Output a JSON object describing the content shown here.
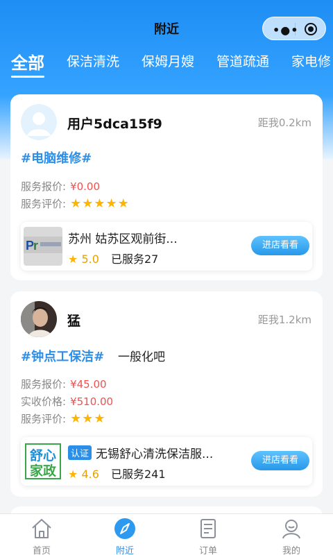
{
  "navbar": {
    "title": "附近"
  },
  "tabs": [
    {
      "label": "全部",
      "active": true
    },
    {
      "label": "保洁清洗"
    },
    {
      "label": "保姆月嫂"
    },
    {
      "label": "管道疏通"
    },
    {
      "label": "家电修"
    }
  ],
  "cards": [
    {
      "username": "用户5dca15f9",
      "distance": "距我0.2km",
      "tag": "#电脑维修#",
      "desc": "",
      "price_label": "服务报价:",
      "price_value": "¥0.00",
      "rating_label": "服务评价:",
      "stars": "★★★★★",
      "rating_level": 5,
      "shop": {
        "badge": "",
        "name": "苏州 姑苏区观前街...",
        "score": "5.0",
        "served": "已服务27",
        "button": "进店看看"
      }
    },
    {
      "username": "猛",
      "distance": "距我1.2km",
      "tag": "#钟点工保洁#",
      "desc": "一般化吧",
      "price_label": "服务报价:",
      "price_value": "¥45.00",
      "actual_label": "实收价格:",
      "actual_value": "¥510.00",
      "rating_label": "服务评价:",
      "stars": "★★★",
      "rating_level": 3,
      "shop": {
        "badge": "认证",
        "name": "无锡舒心清洗保洁服...",
        "logo_text": [
          "舒心",
          "家政"
        ],
        "score": "4.6",
        "served": "已服务241",
        "button": "进店看看"
      }
    }
  ],
  "tabbar": [
    {
      "label": "首页",
      "icon": "home-icon"
    },
    {
      "label": "附近",
      "icon": "compass-icon",
      "active": true
    },
    {
      "label": "订单",
      "icon": "order-icon"
    },
    {
      "label": "我的",
      "icon": "user-icon"
    }
  ],
  "colors": {
    "primary": "#2b8ee8",
    "price": "#f05050",
    "star": "#ffb400"
  }
}
